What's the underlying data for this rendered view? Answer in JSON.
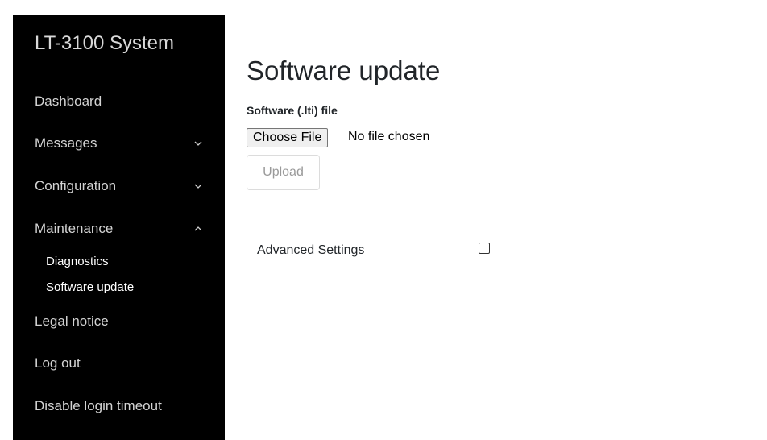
{
  "sidebar": {
    "brand": "LT-3100 System",
    "items": [
      {
        "label": "Dashboard"
      },
      {
        "label": "Messages",
        "chevron": "chevron-down"
      },
      {
        "label": "Configuration",
        "chevron": "chevron-down"
      },
      {
        "label": "Maintenance",
        "chevron": "chevron-up"
      }
    ],
    "maintenance_sub": [
      {
        "label": "Diagnostics"
      },
      {
        "label": "Software update"
      }
    ],
    "bottom_items": [
      {
        "label": "Legal notice"
      },
      {
        "label": "Log out"
      },
      {
        "label": "Disable login timeout"
      }
    ]
  },
  "main": {
    "title": "Software update",
    "file_label": "Software (.lti) file",
    "choose_button": "Choose File",
    "no_file_text": "No file chosen",
    "upload_button": "Upload",
    "advanced_label": "Advanced Settings",
    "advanced_checked": false
  },
  "colors": {
    "sidebar_bg": "#000000",
    "sidebar_text": "#d3d3d3",
    "main_bg": "#ffffff"
  }
}
